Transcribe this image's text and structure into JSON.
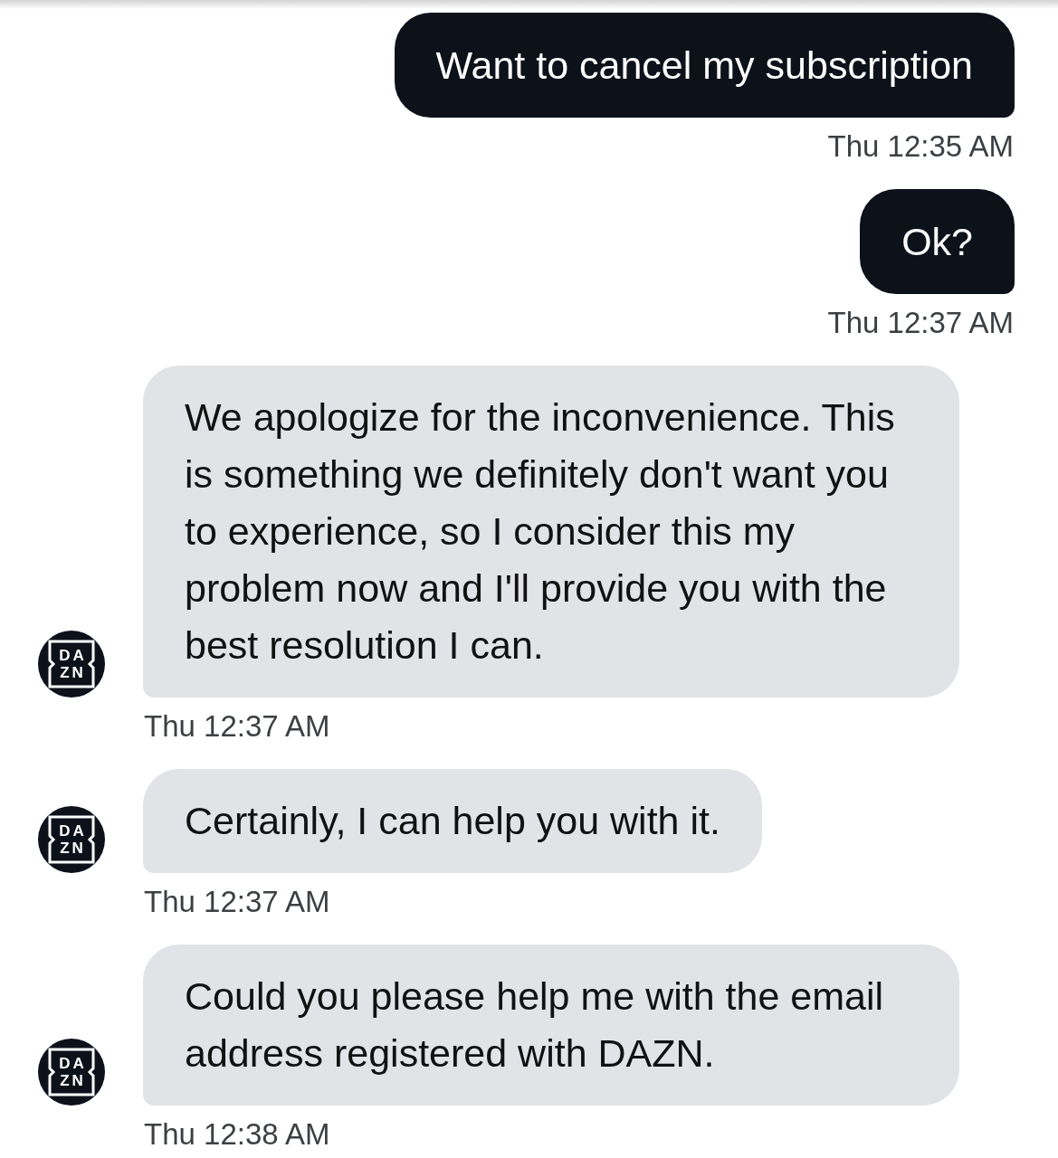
{
  "messages": [
    {
      "kind": "outgoing",
      "text": "Want to cancel my subscription",
      "time": "Thu 12:35 AM"
    },
    {
      "kind": "outgoing",
      "text": "Ok?",
      "time": "Thu 12:37 AM"
    },
    {
      "kind": "incoming",
      "avatar": [
        "DA",
        "ZN"
      ],
      "text": "We apologize for the inconvenience. This is something we definitely don't want you to experience, so I consider this my problem now and I'll provide you with the best resolution I can.",
      "time": "Thu 12:37 AM"
    },
    {
      "kind": "incoming",
      "avatar": [
        "DA",
        "ZN"
      ],
      "text": "Certainly, I can help you with it.",
      "time": "Thu 12:37 AM"
    },
    {
      "kind": "incoming",
      "avatar": [
        "DA",
        "ZN"
      ],
      "text": "Could you please help me with the email address registered with DAZN.",
      "time": "Thu 12:38 AM"
    }
  ]
}
